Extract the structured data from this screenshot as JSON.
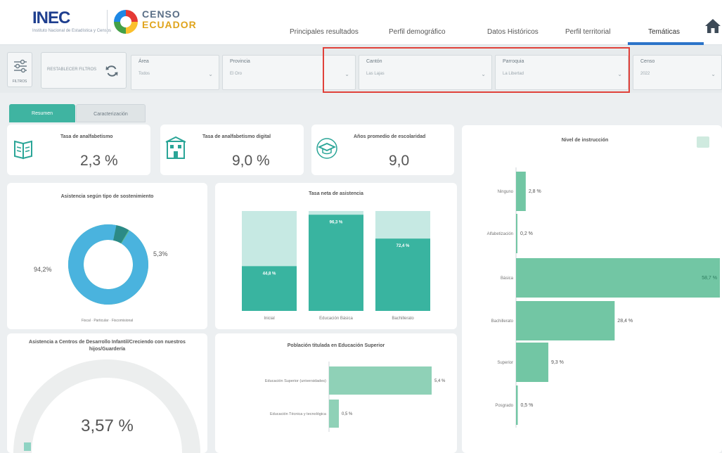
{
  "header": {
    "logo_inec": "INEC",
    "logo_inec_tagline": "Instituto Nacional de Estadística y Censos",
    "logo_censo_line1": "CENSO",
    "logo_censo_line2": "ECUADOR",
    "logo_censo_line3": "",
    "nav": [
      {
        "label": "Principales resultados"
      },
      {
        "label": "Perfil demográfico"
      },
      {
        "label": "Datos Históricos"
      },
      {
        "label": "Perfil territorial"
      },
      {
        "label": "Temáticas"
      }
    ]
  },
  "filters": {
    "toggle_label": "FILTROS",
    "reset_label": "RESTABLECER FILTROS",
    "items": [
      {
        "label": "Área",
        "value": "Todos"
      },
      {
        "label": "Provincia",
        "value": "El Oro"
      },
      {
        "label": "Cantón",
        "value": "Las Lajas"
      },
      {
        "label": "Parroquia",
        "value": "La Libertad"
      },
      {
        "label": "Censo",
        "value": "2022"
      }
    ]
  },
  "tabs": {
    "active": "Resumen",
    "inactive": "Caracterización"
  },
  "kpis": [
    {
      "title": "Tasa de analfabetismo",
      "value": "2,3 %"
    },
    {
      "title": "Tasa de analfabetismo digital",
      "value": "9,0 %"
    },
    {
      "title": "Años promedio de escolaridad",
      "value": "9,0"
    }
  ],
  "donut": {
    "title": "Asistencia según tipo de sostenimiento",
    "label_main": "94,2%",
    "label_secondary": "5,3%",
    "legend": "Fiscal · Particular · Fiscomisional",
    "main_share": 0.942,
    "secondary_share": 0.053,
    "color_main": "#4ab3de",
    "color_secondary": "#2b8a86",
    "color_tertiary": "#5fbf8c"
  },
  "attendance": {
    "title": "Tasa neta de asistencia",
    "bars": [
      {
        "category": "Inicial",
        "value_label": "44,8 %",
        "value": 44.8
      },
      {
        "category": "Educación Básica",
        "value_label": "96,3 %",
        "value": 96.3
      },
      {
        "category": "Bachillerato",
        "value_label": "72,4 %",
        "value": 72.4
      }
    ],
    "color_fill": "#39b4a0",
    "color_bg": "#c6e9e3"
  },
  "nivel": {
    "title": "Nivel de instrucción",
    "rows": [
      {
        "label": "Ninguno",
        "value_label": "2,8 %",
        "value": 2.8
      },
      {
        "label": "Alfabetización",
        "value_label": "0,2 %",
        "value": 0.2
      },
      {
        "label": "Básica",
        "value_label": "58,7 %",
        "value": 58.7
      },
      {
        "label": "Bachillerato",
        "value_label": "28,4 %",
        "value": 28.4
      },
      {
        "label": "Superior",
        "value_label": "9,3 %",
        "value": 9.3
      },
      {
        "label": "Posgrado",
        "value_label": "0,5 %",
        "value": 0.5
      }
    ],
    "color": "#72c6a4"
  },
  "superior": {
    "title": "Población titulada en Educación Superior",
    "rows": [
      {
        "label": "Educación Superior (universidades)",
        "value_label": "5,4 %",
        "value": 5.4
      },
      {
        "label": "Educación Técnica y tecnológica",
        "value_label": "0,5 %",
        "value": 0.5
      }
    ],
    "color": "#8fd1b7"
  },
  "gauge": {
    "title": "Asistencia a Centros de Desarrollo Infantil/Creciendo con nuestros hijos/Guardería",
    "value_label": "3,57 %",
    "value": 3.57
  }
}
